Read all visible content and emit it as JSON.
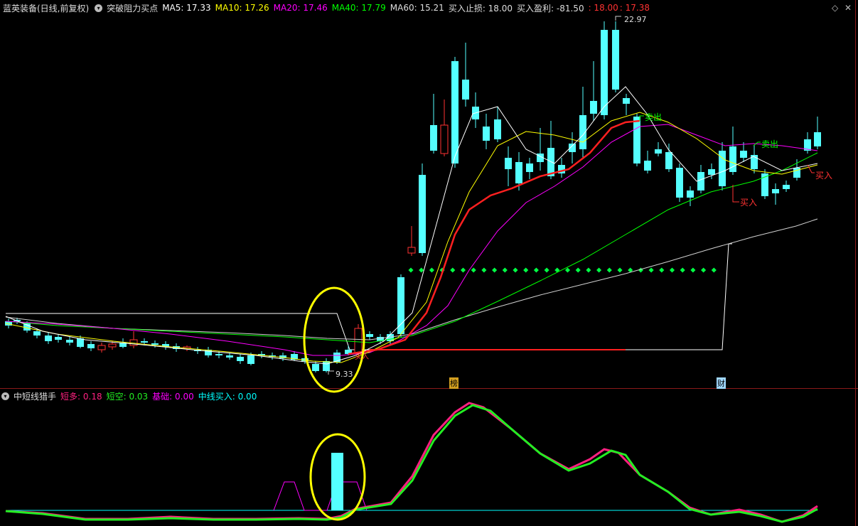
{
  "main_header": {
    "stock": "蓝英装备(日线,前复权)",
    "indicator": "突破阻力买点",
    "ma5": "MA5: 17.33",
    "ma10": "MA10: 17.26",
    "ma20": "MA20: 17.46",
    "ma40": "MA40: 17.79",
    "ma60": "MA60: 15.21",
    "buy_stop": "买入止损: 18.00",
    "buy_profit": "买入盈利: -81.50",
    "price_a": ": 18.00",
    "price_b": ": 17.38"
  },
  "sub_header": {
    "indicator": "中短线猎手",
    "short_long": "短多: 0.18",
    "short_short": "短空: 0.03",
    "base": "基础: 0.00",
    "mid_buy": "中线买入: 0.00"
  },
  "annotations": {
    "high_price": "22.97",
    "low_price": "9.33",
    "sell_1": "卖出",
    "sell_2": "卖出",
    "buy_1": "买入",
    "buy_2": "买入",
    "buy_3": "买入",
    "tag_bang": "榜",
    "tag_cai": "财"
  },
  "window_controls": {
    "diamond": "◇",
    "close": "✕"
  },
  "colors": {
    "up": "#ff3232",
    "down": "#54ffff",
    "ma5": "#ffffff",
    "ma10": "#ffff00",
    "ma20": "#ff00ff",
    "ma40": "#00ff00",
    "ma60": "#cccccc",
    "short_long": "#ff2080",
    "short_short": "#22ee22",
    "mid_buy": "#00ffff",
    "dotted": "#00ff44",
    "highlight": "#ffff00"
  }
}
